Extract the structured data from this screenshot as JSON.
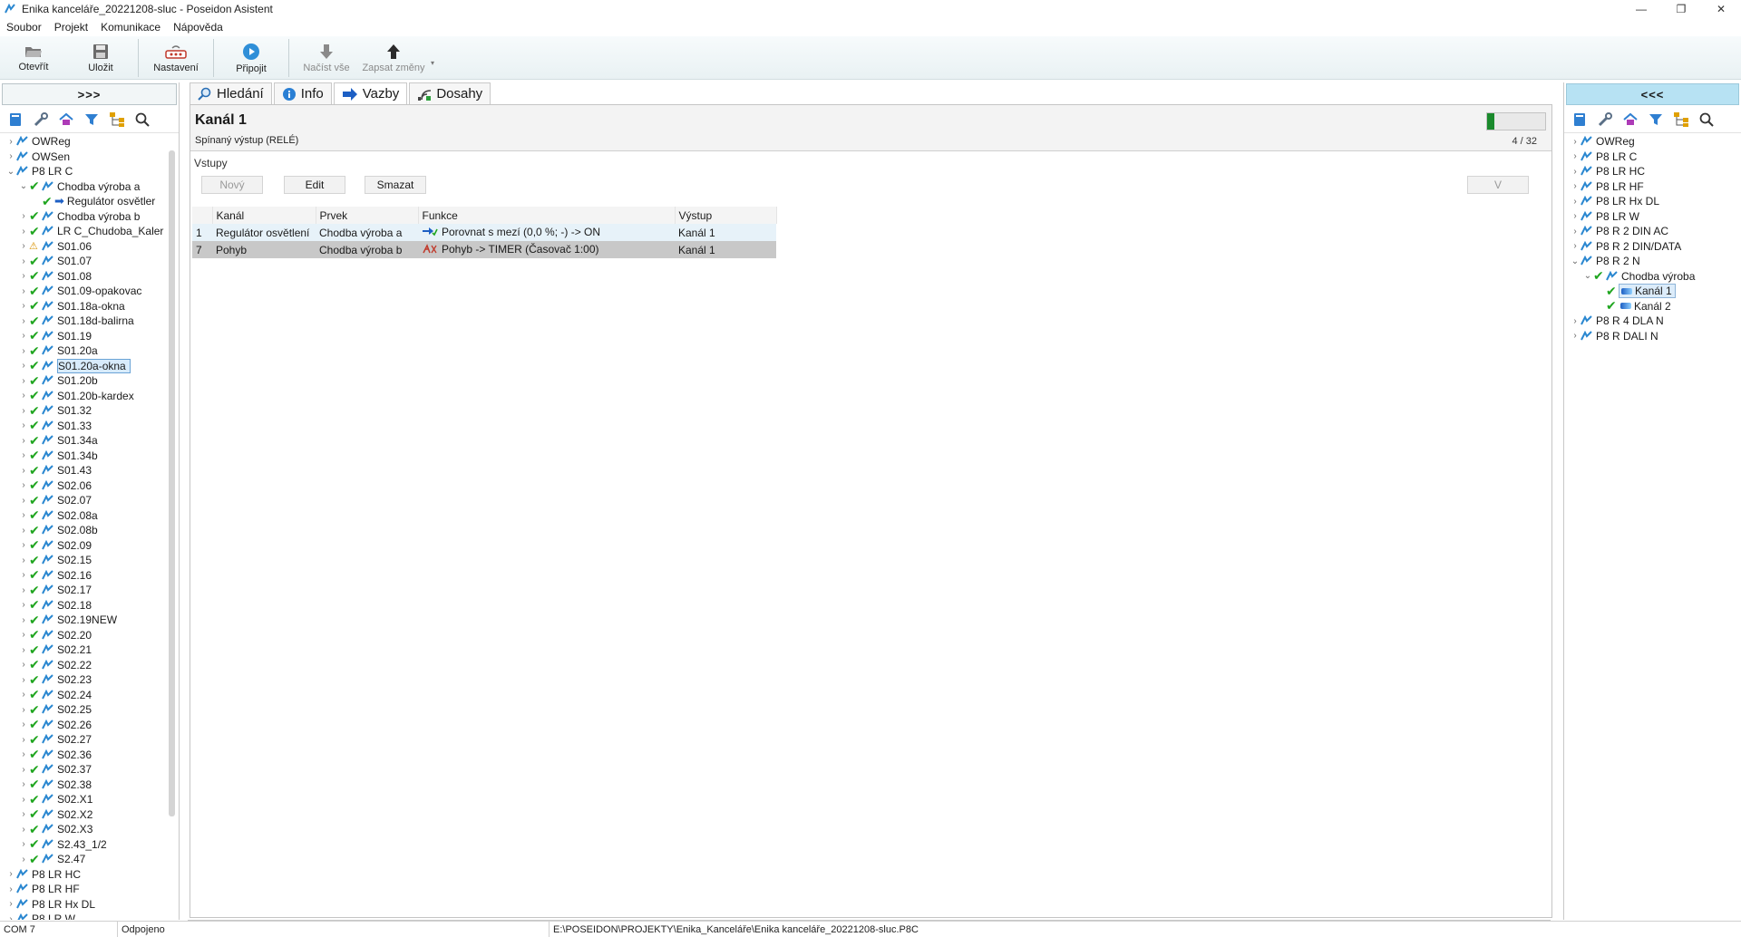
{
  "window": {
    "title": "Enika kanceláře_20221208-sluc - Poseidon Asistent",
    "minimize": "—",
    "maximize": "❐",
    "close": "✕"
  },
  "menu": [
    "Soubor",
    "Projekt",
    "Komunikace",
    "Nápověda"
  ],
  "toolbar": {
    "open": "Otevřít",
    "save": "Uložit",
    "settings": "Nastavení",
    "connect": "Připojit",
    "load_all": "Načíst vše",
    "write_changes": "Zapsat změny"
  },
  "left_panel": {
    "collapse_label": ">>>",
    "tree_top": [
      "OWReg",
      "OWSen",
      "P8 LR C"
    ],
    "group_open": "Chodba výroba a",
    "group_child": "Regulátor osvětler",
    "items": [
      "Chodba výroba b",
      "LR C_Chudoba_Kaler",
      "S01.06",
      "S01.07",
      "S01.08",
      "S01.09-opakovac",
      "S01.18a-okna",
      "S01.18d-balirna",
      "S01.19",
      "S01.20a",
      "S01.20a-okna",
      "S01.20b",
      "S01.20b-kardex",
      "S01.32",
      "S01.33",
      "S01.34a",
      "S01.34b",
      "S01.43",
      "S02.06",
      "S02.07",
      "S02.08a",
      "S02.08b",
      "S02.09",
      "S02.15",
      "S02.16",
      "S02.17",
      "S02.18",
      "S02.19NEW",
      "S02.20",
      "S02.21",
      "S02.22",
      "S02.23",
      "S02.24",
      "S02.25",
      "S02.26",
      "S02.27",
      "S02.36",
      "S02.37",
      "S02.38",
      "S02.X1",
      "S02.X2",
      "S02.X3",
      "S2.43_1/2",
      "S2.47"
    ],
    "tree_bottom": [
      "P8 LR HC",
      "P8 LR HF",
      "P8 LR Hx DL",
      "P8 LR W"
    ]
  },
  "tabs": [
    {
      "label": "Hledání"
    },
    {
      "label": "Info"
    },
    {
      "label": "Vazby"
    },
    {
      "label": "Dosahy"
    }
  ],
  "channel": {
    "title": "Kanál 1",
    "subtitle": "Spínaný výstup (RELÉ)",
    "progress_label": "4 / 32",
    "progress_value": 0.125
  },
  "inputs": {
    "section": "Vstupy",
    "new": "Nový",
    "edit": "Edit",
    "delete": "Smazat",
    "v": "V",
    "columns": [
      "Kanál",
      "Prvek",
      "Funkce",
      "Výstup"
    ],
    "rows": [
      {
        "num": "1",
        "kanal": "Regulátor osvětlení",
        "prvek": "Chodba výroba a",
        "funkce": "Porovnat s mezí (0,0 %; -) -> ON",
        "vystup": "Kanál 1"
      },
      {
        "num": "7",
        "kanal": "Pohyb",
        "prvek": "Chodba výroba b",
        "funkce": "Pohyb -> TIMER (Časovač 1:00)",
        "vystup": "Kanál 1"
      }
    ]
  },
  "right_panel": {
    "collapse_label": "<<<",
    "items_top": [
      "OWReg",
      "P8 LR C",
      "P8 LR HC",
      "P8 LR HF",
      "P8 LR Hx DL",
      "P8 LR W",
      "P8 R 2 DIN AC",
      "P8 R 2 DIN/DATA",
      "P8 R 2 N"
    ],
    "group": "Chodba výroba",
    "channels": [
      "Kanál 1",
      "Kanál 2"
    ],
    "items_bottom": [
      "P8 R 4 DLA N",
      "P8 R DALI N"
    ]
  },
  "status": {
    "port": "COM 7",
    "state": "Odpojeno",
    "path": "E:\\POSEIDON\\PROJEKTY\\Enika_Kanceláře\\Enika kanceláře_20221208-sluc.P8C"
  },
  "colors": {
    "accent": "#b7e2f3",
    "ok": "#1fa51f",
    "progress": "#1a8a2c"
  }
}
